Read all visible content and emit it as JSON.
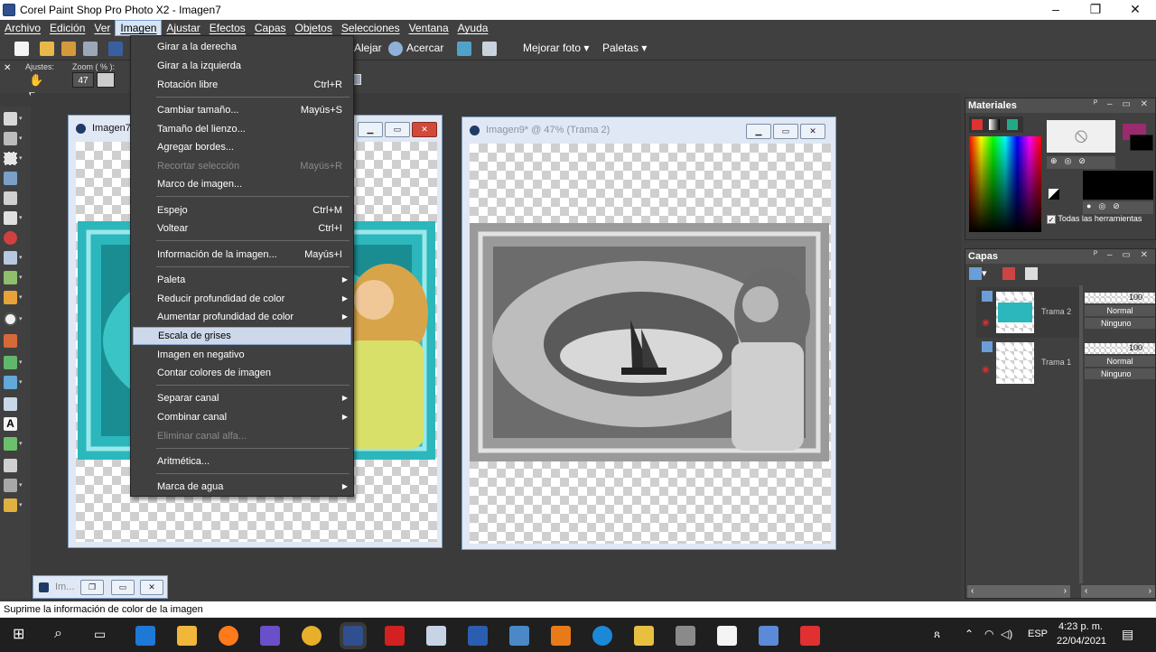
{
  "window": {
    "title": "Corel Paint Shop Pro Photo X2 - Imagen7",
    "minimize": "–",
    "restore": "❐",
    "close": "✕"
  },
  "menubar": [
    "Archivo",
    "Edición",
    "Ver",
    "Imagen",
    "Ajustar",
    "Efectos",
    "Capas",
    "Objetos",
    "Selecciones",
    "Ventana",
    "Ayuda"
  ],
  "toolbar": {
    "zoom_out": "Alejar",
    "zoom_in": "Acercar",
    "enhance_photo": "Mejorar foto",
    "palettes": "Paletas"
  },
  "options": {
    "presets_label": "Ajustes:",
    "zoom_label": "Zoom ( % ):",
    "zoom_value": "47"
  },
  "image_menu": [
    {
      "label": "Girar a la derecha",
      "shortcut": ""
    },
    {
      "label": "Girar a la izquierda",
      "shortcut": ""
    },
    {
      "label": "Rotación libre",
      "shortcut": "Ctrl+R"
    },
    {
      "label": "Cambiar tamaño...",
      "shortcut": "Mayús+S"
    },
    {
      "label": "Tamaño del lienzo...",
      "shortcut": ""
    },
    {
      "label": "Agregar bordes...",
      "shortcut": ""
    },
    {
      "label": "Recortar selección",
      "shortcut": "Mayús+R"
    },
    {
      "label": "Marco de imagen...",
      "shortcut": ""
    },
    {
      "label": "Espejo",
      "shortcut": "Ctrl+M"
    },
    {
      "label": "Voltear",
      "shortcut": "Ctrl+I"
    },
    {
      "label": "Información de la imagen...",
      "shortcut": "Mayús+I"
    },
    {
      "label": "Paleta",
      "shortcut": ""
    },
    {
      "label": "Reducir profundidad de color",
      "shortcut": ""
    },
    {
      "label": "Aumentar profundidad de color",
      "shortcut": ""
    },
    {
      "label": "Escala de grises",
      "shortcut": ""
    },
    {
      "label": "Imagen en negativo",
      "shortcut": ""
    },
    {
      "label": "Contar colores de imagen",
      "shortcut": ""
    },
    {
      "label": "Separar canal",
      "shortcut": ""
    },
    {
      "label": "Combinar canal",
      "shortcut": ""
    },
    {
      "label": "Eliminar canal alfa...",
      "shortcut": ""
    },
    {
      "label": "Aritmética...",
      "shortcut": ""
    },
    {
      "label": "Marca de agua",
      "shortcut": ""
    }
  ],
  "doc1": {
    "title": "Imagen7"
  },
  "doc2": {
    "title": "Imagen9* @  47% (Trama 2)"
  },
  "minimized": {
    "title": "Im..."
  },
  "materials": {
    "title": "Materiales",
    "all_tools": "Todas las herramientas",
    "fg_color": "#9b2a6e",
    "bg_color": "#000000"
  },
  "layers": {
    "title": "Capas",
    "items": [
      {
        "name": "Trama 2",
        "opacity": "100",
        "blend": "Normal",
        "mask": "Ninguno"
      },
      {
        "name": "Trama 1",
        "opacity": "100",
        "blend": "Normal",
        "mask": "Ninguno"
      }
    ]
  },
  "status": "Suprime la información de color de la imagen",
  "taskbar": {
    "lang": "ESP",
    "time": "4:23 p. m.",
    "date": "22/04/2021"
  }
}
